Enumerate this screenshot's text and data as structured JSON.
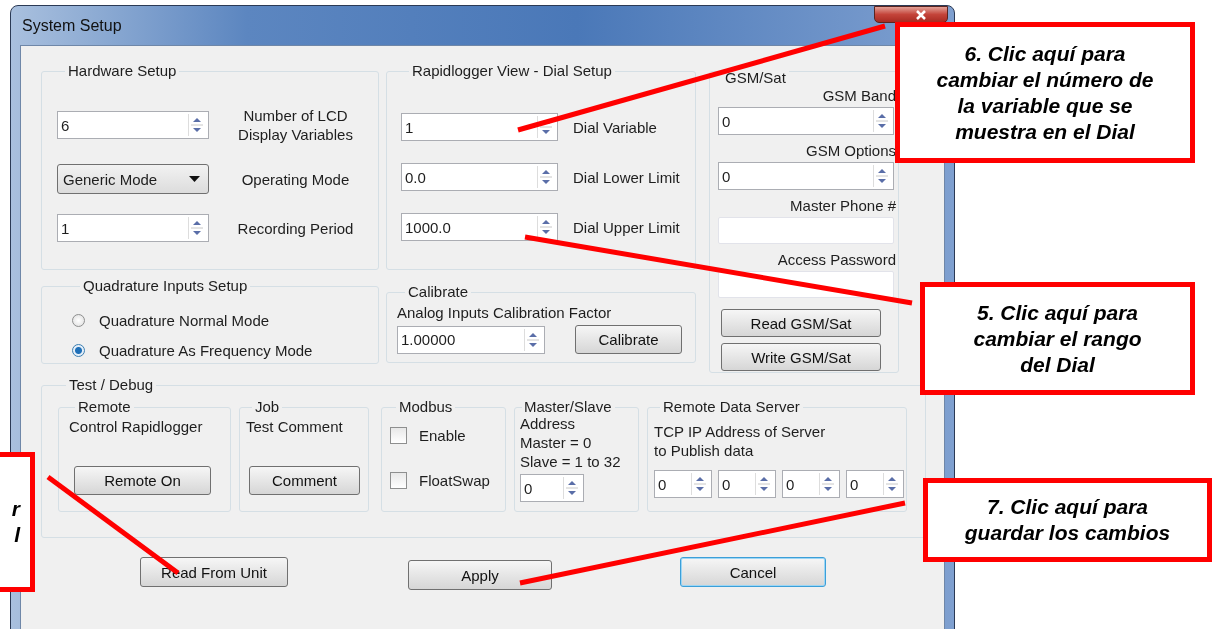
{
  "window": {
    "title": "System Setup"
  },
  "hardware_setup": {
    "title": "Hardware Setup",
    "rows": [
      {
        "kind": "spin",
        "value": "6",
        "label": "Number of LCD\nDisplay Variables"
      },
      {
        "kind": "dropdown",
        "value": "Generic Mode",
        "label": "Operating Mode"
      },
      {
        "kind": "spin",
        "value": "1",
        "label": "Recording Period"
      }
    ]
  },
  "dial_setup": {
    "title": "Rapidlogger View - Dial Setup",
    "rows": [
      {
        "value": "1",
        "label": "Dial Variable"
      },
      {
        "value": "0.0",
        "label": "Dial Lower Limit"
      },
      {
        "value": "1000.0",
        "label": "Dial Upper Limit"
      }
    ]
  },
  "gsm_sat": {
    "title": "GSM/Sat",
    "fields": [
      {
        "kind": "spin",
        "label": "GSM Band",
        "value": "0"
      },
      {
        "kind": "spin",
        "label": "GSM Options",
        "value": "0"
      },
      {
        "kind": "text",
        "label": "Master Phone #"
      },
      {
        "kind": "text",
        "label": "Access Password"
      }
    ],
    "buttons": [
      "Read GSM/Sat",
      "Write GSM/Sat"
    ]
  },
  "quadrature": {
    "title": "Quadrature Inputs Setup",
    "options": [
      {
        "label": "Quadrature Normal Mode",
        "selected": false
      },
      {
        "label": "Quadrature As Frequency Mode",
        "selected": true
      }
    ]
  },
  "calibrate": {
    "title": "Calibrate",
    "label": "Analog Inputs Calibration Factor",
    "value": "1.00000",
    "button": "Calibrate"
  },
  "test_debug": {
    "title": "Test / Debug",
    "remote": {
      "title": "Remote",
      "text": "Control Rapidlogger",
      "button": "Remote On"
    },
    "job": {
      "title": "Job",
      "text": "Test Comment",
      "button": "Comment"
    },
    "modbus": {
      "title": "Modbus",
      "checkboxes": [
        {
          "label": "Enable",
          "checked": false
        },
        {
          "label": "FloatSwap",
          "checked": false
        }
      ]
    },
    "master_slave": {
      "title": "Master/Slave",
      "text": "Address\nMaster = 0\nSlave = 1 to 32",
      "value": "0"
    },
    "remote_data_server": {
      "title": "Remote Data Server",
      "text": "TCP IP Address of Server\nto Publish data",
      "octets": [
        "0",
        "0",
        "0",
        "0"
      ]
    }
  },
  "buttons": [
    {
      "label": "Read From Unit",
      "focused": false
    },
    {
      "label": "Apply",
      "focused": false
    },
    {
      "label": "Cancel",
      "focused": true
    }
  ],
  "callouts": [
    {
      "text": "6. Clic aquí para\ncambiar el número de\nla variable que se\nmuestra en el Dial"
    },
    {
      "text": "5. Clic aquí para\ncambiar el rango\ndel Dial"
    },
    {
      "text": "r\nl"
    },
    {
      "text": "7. Clic aquí para\nguardar los cambios"
    }
  ]
}
